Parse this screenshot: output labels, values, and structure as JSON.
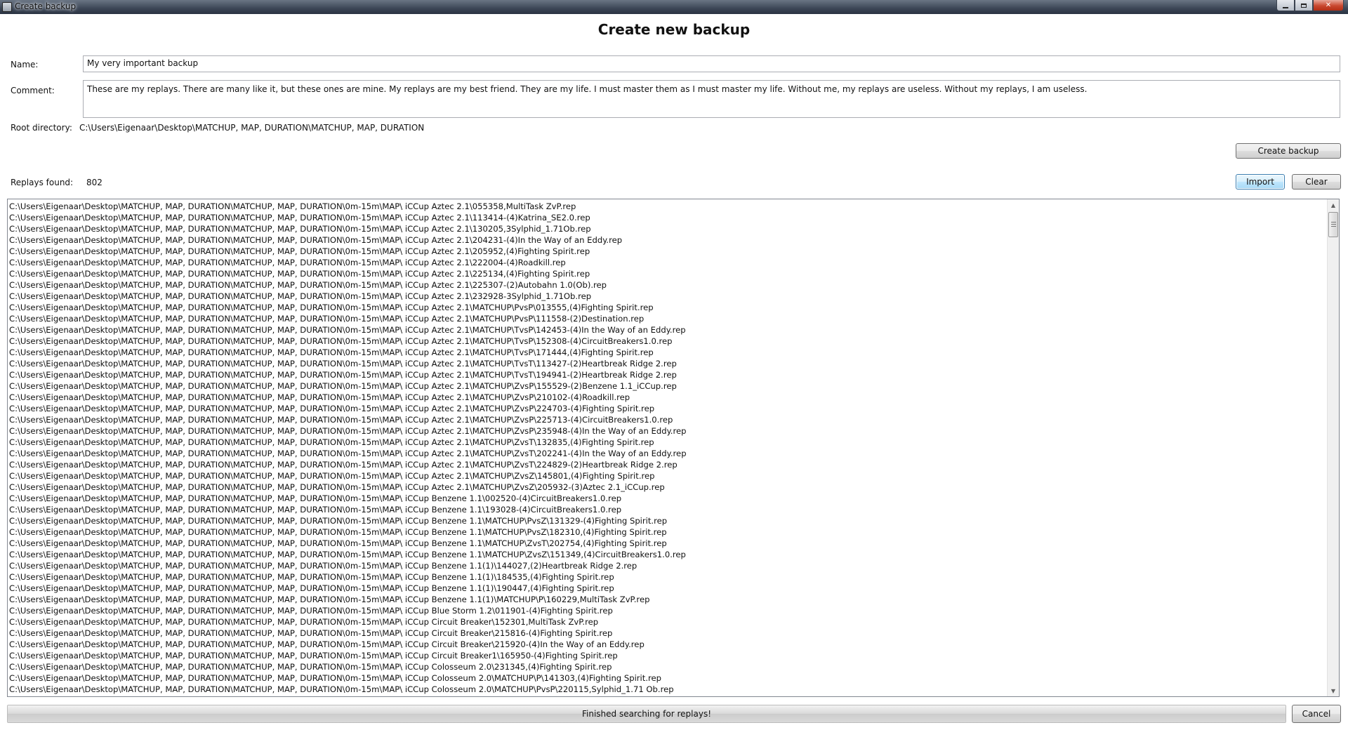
{
  "window": {
    "title": "Create backup"
  },
  "heading": "Create new backup",
  "form": {
    "name_label": "Name:",
    "name_value": "My very important backup",
    "comment_label": "Comment:",
    "comment_value": "These are my replays. There are many like it, but these ones are mine. My replays are my best friend. They are my life. I must master them as I must master my life. Without me, my replays are useless. Without my replays, I am useless.",
    "root_label": "Root directory:",
    "root_value": "C:\\Users\\Eigenaar\\Desktop\\MATCHUP, MAP, DURATION\\MATCHUP, MAP, DURATION"
  },
  "buttons": {
    "create_backup": "Create backup",
    "import": "Import",
    "clear": "Clear",
    "cancel": "Cancel"
  },
  "replays": {
    "found_label": "Replays found:",
    "found_count": "802",
    "items": [
      "C:\\Users\\Eigenaar\\Desktop\\MATCHUP, MAP, DURATION\\MATCHUP, MAP, DURATION\\0m-15m\\MAP\\ iCCup  Aztec 2.1\\055358,MultiTask ZvP.rep",
      "C:\\Users\\Eigenaar\\Desktop\\MATCHUP, MAP, DURATION\\MATCHUP, MAP, DURATION\\0m-15m\\MAP\\ iCCup  Aztec 2.1\\113414-(4)Katrina_SE2.0.rep",
      "C:\\Users\\Eigenaar\\Desktop\\MATCHUP, MAP, DURATION\\MATCHUP, MAP, DURATION\\0m-15m\\MAP\\ iCCup  Aztec 2.1\\130205,3Sylphid_1.71Ob.rep",
      "C:\\Users\\Eigenaar\\Desktop\\MATCHUP, MAP, DURATION\\MATCHUP, MAP, DURATION\\0m-15m\\MAP\\ iCCup  Aztec 2.1\\204231-(4)In the Way of an Eddy.rep",
      "C:\\Users\\Eigenaar\\Desktop\\MATCHUP, MAP, DURATION\\MATCHUP, MAP, DURATION\\0m-15m\\MAP\\ iCCup  Aztec 2.1\\205952,(4)Fighting Spirit.rep",
      "C:\\Users\\Eigenaar\\Desktop\\MATCHUP, MAP, DURATION\\MATCHUP, MAP, DURATION\\0m-15m\\MAP\\ iCCup  Aztec 2.1\\222004-(4)Roadkill.rep",
      "C:\\Users\\Eigenaar\\Desktop\\MATCHUP, MAP, DURATION\\MATCHUP, MAP, DURATION\\0m-15m\\MAP\\ iCCup  Aztec 2.1\\225134,(4)Fighting Spirit.rep",
      "C:\\Users\\Eigenaar\\Desktop\\MATCHUP, MAP, DURATION\\MATCHUP, MAP, DURATION\\0m-15m\\MAP\\ iCCup  Aztec 2.1\\225307-(2)Autobahn 1.0(Ob).rep",
      "C:\\Users\\Eigenaar\\Desktop\\MATCHUP, MAP, DURATION\\MATCHUP, MAP, DURATION\\0m-15m\\MAP\\ iCCup  Aztec 2.1\\232928-3Sylphid_1.71Ob.rep",
      "C:\\Users\\Eigenaar\\Desktop\\MATCHUP, MAP, DURATION\\MATCHUP, MAP, DURATION\\0m-15m\\MAP\\ iCCup  Aztec 2.1\\MATCHUP\\PvsP\\013555,(4)Fighting Spirit.rep",
      "C:\\Users\\Eigenaar\\Desktop\\MATCHUP, MAP, DURATION\\MATCHUP, MAP, DURATION\\0m-15m\\MAP\\ iCCup  Aztec 2.1\\MATCHUP\\PvsP\\111558-(2)Destination.rep",
      "C:\\Users\\Eigenaar\\Desktop\\MATCHUP, MAP, DURATION\\MATCHUP, MAP, DURATION\\0m-15m\\MAP\\ iCCup  Aztec 2.1\\MATCHUP\\TvsP\\142453-(4)In the Way of an Eddy.rep",
      "C:\\Users\\Eigenaar\\Desktop\\MATCHUP, MAP, DURATION\\MATCHUP, MAP, DURATION\\0m-15m\\MAP\\ iCCup  Aztec 2.1\\MATCHUP\\TvsP\\152308-(4)CircuitBreakers1.0.rep",
      "C:\\Users\\Eigenaar\\Desktop\\MATCHUP, MAP, DURATION\\MATCHUP, MAP, DURATION\\0m-15m\\MAP\\ iCCup  Aztec 2.1\\MATCHUP\\TvsP\\171444,(4)Fighting Spirit.rep",
      "C:\\Users\\Eigenaar\\Desktop\\MATCHUP, MAP, DURATION\\MATCHUP, MAP, DURATION\\0m-15m\\MAP\\ iCCup  Aztec 2.1\\MATCHUP\\TvsT\\113427-(2)Heartbreak Ridge 2.rep",
      "C:\\Users\\Eigenaar\\Desktop\\MATCHUP, MAP, DURATION\\MATCHUP, MAP, DURATION\\0m-15m\\MAP\\ iCCup  Aztec 2.1\\MATCHUP\\TvsT\\194941-(2)Heartbreak Ridge 2.rep",
      "C:\\Users\\Eigenaar\\Desktop\\MATCHUP, MAP, DURATION\\MATCHUP, MAP, DURATION\\0m-15m\\MAP\\ iCCup  Aztec 2.1\\MATCHUP\\ZvsP\\155529-(2)Benzene 1.1_iCCup.rep",
      "C:\\Users\\Eigenaar\\Desktop\\MATCHUP, MAP, DURATION\\MATCHUP, MAP, DURATION\\0m-15m\\MAP\\ iCCup  Aztec 2.1\\MATCHUP\\ZvsP\\210102-(4)Roadkill.rep",
      "C:\\Users\\Eigenaar\\Desktop\\MATCHUP, MAP, DURATION\\MATCHUP, MAP, DURATION\\0m-15m\\MAP\\ iCCup  Aztec 2.1\\MATCHUP\\ZvsP\\224703-(4)Fighting Spirit.rep",
      "C:\\Users\\Eigenaar\\Desktop\\MATCHUP, MAP, DURATION\\MATCHUP, MAP, DURATION\\0m-15m\\MAP\\ iCCup  Aztec 2.1\\MATCHUP\\ZvsP\\225713-(4)CircuitBreakers1.0.rep",
      "C:\\Users\\Eigenaar\\Desktop\\MATCHUP, MAP, DURATION\\MATCHUP, MAP, DURATION\\0m-15m\\MAP\\ iCCup  Aztec 2.1\\MATCHUP\\ZvsP\\235948-(4)In the Way of an Eddy.rep",
      "C:\\Users\\Eigenaar\\Desktop\\MATCHUP, MAP, DURATION\\MATCHUP, MAP, DURATION\\0m-15m\\MAP\\ iCCup  Aztec 2.1\\MATCHUP\\ZvsT\\132835,(4)Fighting Spirit.rep",
      "C:\\Users\\Eigenaar\\Desktop\\MATCHUP, MAP, DURATION\\MATCHUP, MAP, DURATION\\0m-15m\\MAP\\ iCCup  Aztec 2.1\\MATCHUP\\ZvsT\\202241-(4)In the Way of an Eddy.rep",
      "C:\\Users\\Eigenaar\\Desktop\\MATCHUP, MAP, DURATION\\MATCHUP, MAP, DURATION\\0m-15m\\MAP\\ iCCup  Aztec 2.1\\MATCHUP\\ZvsT\\224829-(2)Heartbreak Ridge 2.rep",
      "C:\\Users\\Eigenaar\\Desktop\\MATCHUP, MAP, DURATION\\MATCHUP, MAP, DURATION\\0m-15m\\MAP\\ iCCup  Aztec 2.1\\MATCHUP\\ZvsZ\\145801,(4)Fighting Spirit.rep",
      "C:\\Users\\Eigenaar\\Desktop\\MATCHUP, MAP, DURATION\\MATCHUP, MAP, DURATION\\0m-15m\\MAP\\ iCCup  Aztec 2.1\\MATCHUP\\ZvsZ\\205932-(3)Aztec 2.1_iCCup.rep",
      "C:\\Users\\Eigenaar\\Desktop\\MATCHUP, MAP, DURATION\\MATCHUP, MAP, DURATION\\0m-15m\\MAP\\ iCCup  Benzene 1.1\\002520-(4)CircuitBreakers1.0.rep",
      "C:\\Users\\Eigenaar\\Desktop\\MATCHUP, MAP, DURATION\\MATCHUP, MAP, DURATION\\0m-15m\\MAP\\ iCCup  Benzene 1.1\\193028-(4)CircuitBreakers1.0.rep",
      "C:\\Users\\Eigenaar\\Desktop\\MATCHUP, MAP, DURATION\\MATCHUP, MAP, DURATION\\0m-15m\\MAP\\ iCCup  Benzene 1.1\\MATCHUP\\PvsZ\\131329-(4)Fighting Spirit.rep",
      "C:\\Users\\Eigenaar\\Desktop\\MATCHUP, MAP, DURATION\\MATCHUP, MAP, DURATION\\0m-15m\\MAP\\ iCCup  Benzene 1.1\\MATCHUP\\PvsZ\\182310,(4)Fighting Spirit.rep",
      "C:\\Users\\Eigenaar\\Desktop\\MATCHUP, MAP, DURATION\\MATCHUP, MAP, DURATION\\0m-15m\\MAP\\ iCCup  Benzene 1.1\\MATCHUP\\ZvsT\\202754,(4)Fighting Spirit.rep",
      "C:\\Users\\Eigenaar\\Desktop\\MATCHUP, MAP, DURATION\\MATCHUP, MAP, DURATION\\0m-15m\\MAP\\ iCCup  Benzene 1.1\\MATCHUP\\ZvsZ\\151349,(4)CircuitBreakers1.0.rep",
      "C:\\Users\\Eigenaar\\Desktop\\MATCHUP, MAP, DURATION\\MATCHUP, MAP, DURATION\\0m-15m\\MAP\\ iCCup  Benzene 1.1(1)\\144027,(2)Heartbreak Ridge 2.rep",
      "C:\\Users\\Eigenaar\\Desktop\\MATCHUP, MAP, DURATION\\MATCHUP, MAP, DURATION\\0m-15m\\MAP\\ iCCup  Benzene 1.1(1)\\184535,(4)Fighting Spirit.rep",
      "C:\\Users\\Eigenaar\\Desktop\\MATCHUP, MAP, DURATION\\MATCHUP, MAP, DURATION\\0m-15m\\MAP\\ iCCup  Benzene 1.1(1)\\190447,(4)Fighting Spirit.rep",
      "C:\\Users\\Eigenaar\\Desktop\\MATCHUP, MAP, DURATION\\MATCHUP, MAP, DURATION\\0m-15m\\MAP\\ iCCup  Benzene 1.1(1)\\MATCHUP\\P\\160229,MultiTask ZvP.rep",
      "C:\\Users\\Eigenaar\\Desktop\\MATCHUP, MAP, DURATION\\MATCHUP, MAP, DURATION\\0m-15m\\MAP\\ iCCup  Blue Storm 1.2\\011901-(4)Fighting Spirit.rep",
      "C:\\Users\\Eigenaar\\Desktop\\MATCHUP, MAP, DURATION\\MATCHUP, MAP, DURATION\\0m-15m\\MAP\\ iCCup  Circuit Breaker\\152301,MultiTask ZvP.rep",
      "C:\\Users\\Eigenaar\\Desktop\\MATCHUP, MAP, DURATION\\MATCHUP, MAP, DURATION\\0m-15m\\MAP\\ iCCup  Circuit Breaker\\215816-(4)Fighting Spirit.rep",
      "C:\\Users\\Eigenaar\\Desktop\\MATCHUP, MAP, DURATION\\MATCHUP, MAP, DURATION\\0m-15m\\MAP\\ iCCup  Circuit Breaker\\215920-(4)In the Way of an Eddy.rep",
      "C:\\Users\\Eigenaar\\Desktop\\MATCHUP, MAP, DURATION\\MATCHUP, MAP, DURATION\\0m-15m\\MAP\\ iCCup  Circuit Breaker1\\165950-(4)Fighting Spirit.rep",
      "C:\\Users\\Eigenaar\\Desktop\\MATCHUP, MAP, DURATION\\MATCHUP, MAP, DURATION\\0m-15m\\MAP\\ iCCup  Colosseum 2.0\\231345,(4)Fighting Spirit.rep",
      "C:\\Users\\Eigenaar\\Desktop\\MATCHUP, MAP, DURATION\\MATCHUP, MAP, DURATION\\0m-15m\\MAP\\ iCCup  Colosseum 2.0\\MATCHUP\\P\\141303,(4)Fighting Spirit.rep",
      "C:\\Users\\Eigenaar\\Desktop\\MATCHUP, MAP, DURATION\\MATCHUP, MAP, DURATION\\0m-15m\\MAP\\ iCCup  Colosseum 2.0\\MATCHUP\\PvsP\\220115,Sylphid_1.71 Ob.rep"
    ]
  },
  "status": {
    "text": "Finished searching for replays!",
    "progress_percent": 100
  }
}
